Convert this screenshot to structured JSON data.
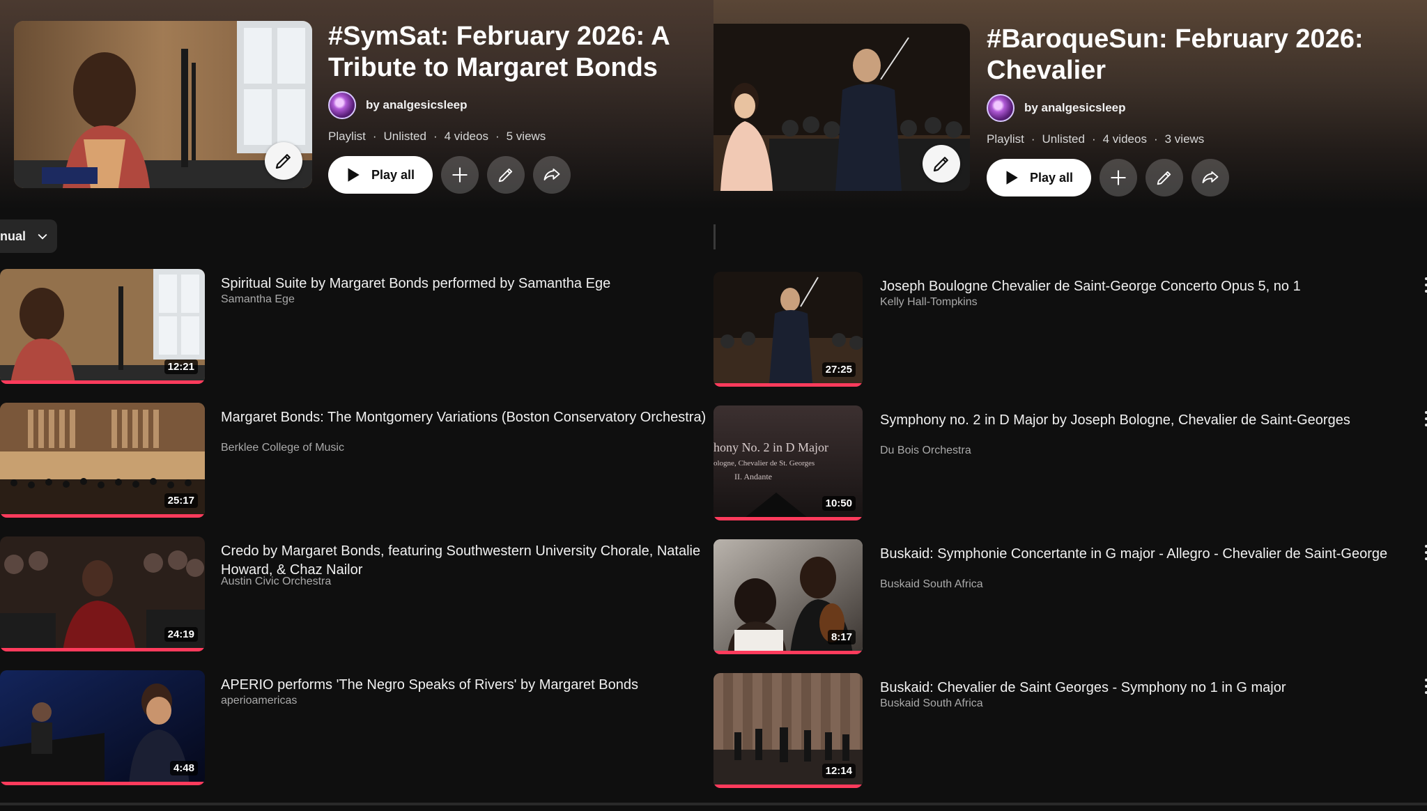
{
  "left": {
    "title": "#SymSat: February 2026: A Tribute to Margaret Bonds",
    "owner": "by analgesicsleep",
    "meta": [
      "Playlist",
      "Unlisted",
      "4 videos",
      "5 views"
    ],
    "play_label": "Play all",
    "sort_label": "nual",
    "videos": [
      {
        "title": "Spiritual Suite by Margaret Bonds performed by Samantha Ege",
        "channel": "Samantha Ege",
        "duration": "12:21"
      },
      {
        "title": "Margaret Bonds: The Montgomery Variations (Boston Conservatory Orchestra)",
        "channel": "Berklee College of Music",
        "duration": "25:17"
      },
      {
        "title": "Credo by Margaret Bonds, featuring Southwestern University Chorale, Natalie Howard, & Chaz Nailor",
        "channel": "Austin Civic Orchestra",
        "duration": "24:19"
      },
      {
        "title": "APERIO performs 'The Negro Speaks of Rivers' by Margaret Bonds",
        "channel": "aperioamericas",
        "duration": "4:48"
      }
    ]
  },
  "right": {
    "title": "#BaroqueSun: February 2026: Chevalier",
    "owner": "by analgesicsleep",
    "meta": [
      "Playlist",
      "Unlisted",
      "4 videos",
      "3 views"
    ],
    "play_label": "Play all",
    "videos": [
      {
        "title": "Joseph Boulogne Chevalier de Saint-George Concerto Opus 5, no 1",
        "channel": "Kelly Hall-Tompkins",
        "duration": "27:25"
      },
      {
        "title": "Symphony no. 2 in D Major by Joseph Bologne, Chevalier de Saint-Georges",
        "channel": "Du Bois Orchestra",
        "duration": "10:50",
        "thumb_text": [
          "hony No. 2 in D Major",
          "ologne, Chevalier de St. Georges",
          "II. Andante"
        ]
      },
      {
        "title": "Buskaid: Symphonie Concertante in G major - Allegro - Chevalier de Saint-George",
        "channel": "Buskaid South Africa",
        "duration": "8:17"
      },
      {
        "title": "Buskaid: Chevalier de Saint Georges - Symphony no 1 in G major",
        "channel": "Buskaid South Africa",
        "duration": "12:14"
      }
    ]
  },
  "icons": {
    "play": "play-icon",
    "add": "plus-icon",
    "edit": "pencil-icon",
    "share": "share-icon",
    "sort": "chevron-down-icon",
    "more": "kebab-icon"
  },
  "colors": {
    "background": "#0f0f0f",
    "progress": "#ff3b5c",
    "play_button": "#ffffff"
  }
}
